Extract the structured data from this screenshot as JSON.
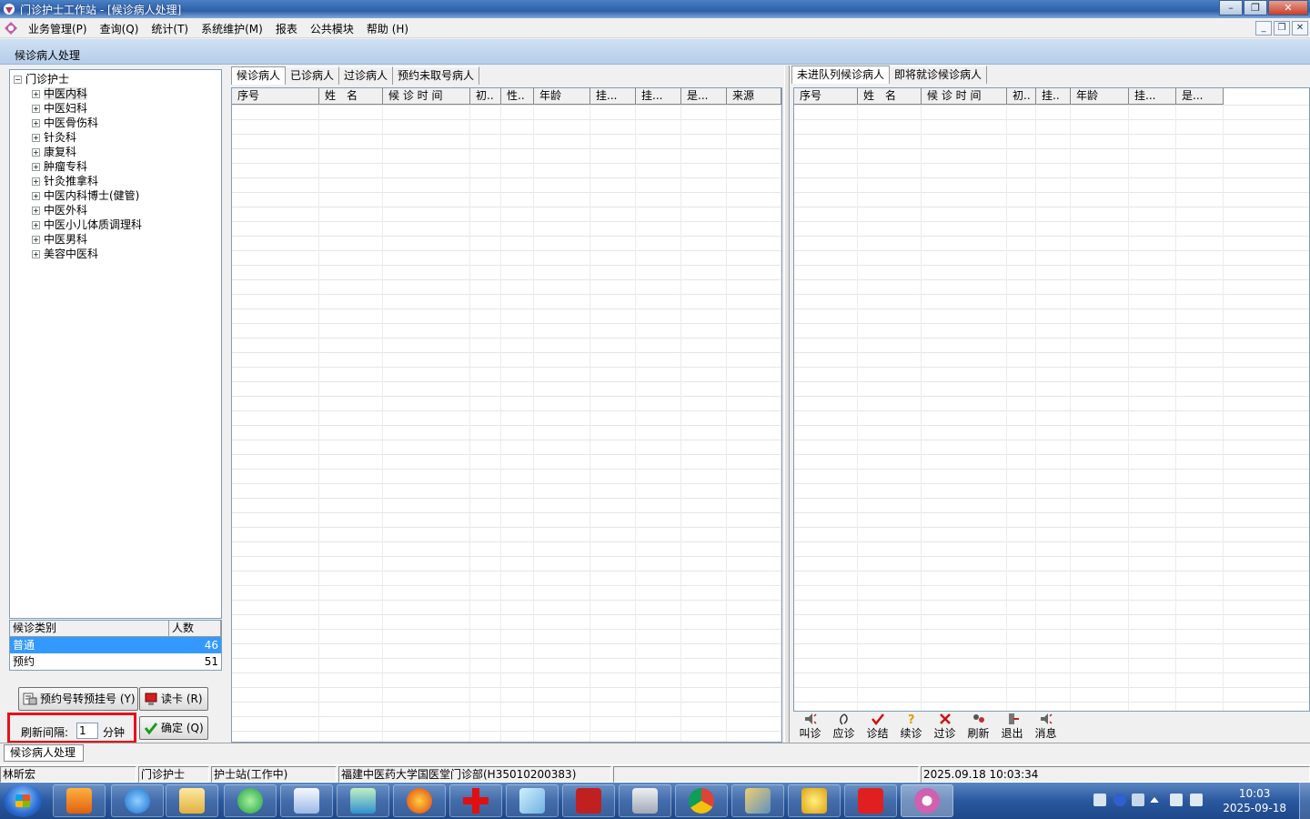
{
  "window": {
    "title": "门诊护士工作站 - [候诊病人处理]"
  },
  "menu": [
    "业务管理(P)",
    "查询(Q)",
    "统计(T)",
    "系统维护(M)",
    "报表",
    "公共模块",
    "帮助 (H)"
  ],
  "child_title": "候诊病人处理",
  "tree": {
    "root": "门诊护士",
    "departments": [
      "中医内科",
      "中医妇科",
      "中医骨伤科",
      "针灸科",
      "康复科",
      "肿瘤专科",
      "针灸推拿科",
      "中医内科博士(健管)",
      "中医外科",
      "中医小儿体质调理科",
      "中医男科",
      "美容中医科"
    ],
    "selected_index": 0
  },
  "category_list": {
    "headers": [
      "候诊类别",
      "人数"
    ],
    "rows": [
      {
        "name": "普通",
        "count": "46"
      },
      {
        "name": "预约",
        "count": "51"
      }
    ]
  },
  "buttons": {
    "appointment_convert": "预约号转预挂号 (Y)",
    "read_card": "读卡 (R)",
    "confirm": "确定 (Q)"
  },
  "refresh": {
    "label": "刷新间隔:",
    "value": "1",
    "unit": "分钟"
  },
  "left_tabs": [
    "候诊病人",
    "已诊病人",
    "过诊病人",
    "预约未取号病人"
  ],
  "left_grid_headers": [
    "序号",
    "姓　名",
    "候 诊 时 间",
    "初..",
    "性..",
    "年龄",
    "挂...",
    "挂...",
    "是...",
    "来源"
  ],
  "right_tabs": [
    "未进队列候诊病人",
    "即将就诊候诊病人"
  ],
  "right_grid_headers": [
    "序号",
    "姓　名",
    "候 诊 时 间",
    "初..",
    "挂..",
    "年龄",
    "挂...",
    "是..."
  ],
  "toolbar": [
    "叫诊",
    "应诊",
    "诊结",
    "续诊",
    "过诊",
    "刷新",
    "退出",
    "消息"
  ],
  "bottom_tab": "候诊病人处理",
  "status": {
    "user": "林昕宏",
    "role": "门诊护士",
    "station": "护士站(工作中)",
    "org": "福建中医药大学国医堂门诊部(H35010200383)",
    "datetime": "2025.09.18 10:03:34"
  },
  "clock": {
    "time": "10:03",
    "date": "2025-09-18"
  }
}
